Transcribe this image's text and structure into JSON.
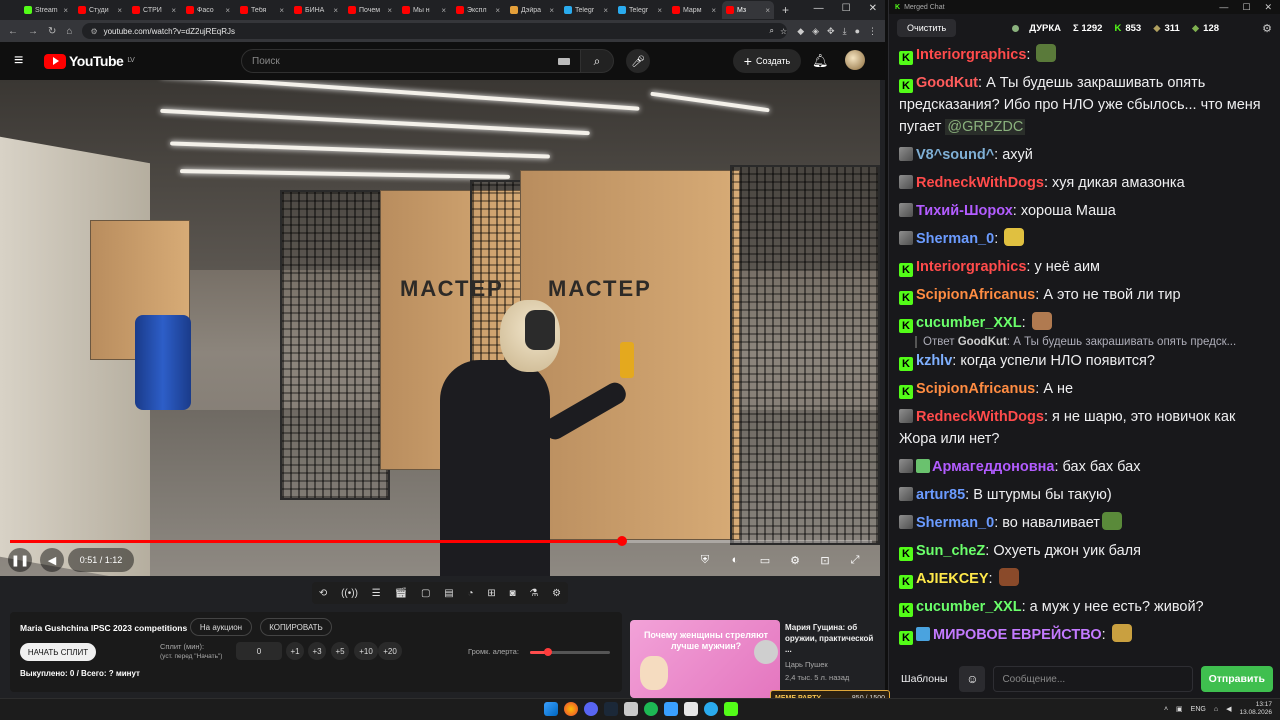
{
  "browser": {
    "tabs": [
      "Stream",
      "Студи",
      "СТРИ",
      "Фасо",
      "Тебя",
      "БИНА",
      "Почем",
      "Мы н",
      "Экспл",
      "Дэйра",
      "Telegr",
      "Telegr",
      "Марм",
      "Мз"
    ],
    "url": "youtube.com/watch?v=dZ2ujREqRJs"
  },
  "youtube": {
    "logo_text": "YouTube",
    "region": "LV",
    "search_placeholder": "Поиск",
    "create_label": "Создать",
    "video": {
      "sign1": "МАСТЕР",
      "sign2": "МАСТЕР",
      "time": "0:51 / 1:12",
      "progress_fraction": 0.71
    }
  },
  "panel": {
    "title": "Maria Gushchina IPSC 2023 competitions",
    "auction_btn": "На аукцион",
    "copy_btn": "КОПИРОВАТЬ",
    "start_split_btn": "НАЧАТЬ СПЛИТ",
    "split_label": "Сплит (мин):",
    "split_hint": "(уст. перед \"Начать\")",
    "split_value": "0",
    "increments": [
      "+1",
      "+3",
      "+5",
      "+10",
      "+20"
    ],
    "alert_label": "Громк. алерта:",
    "alert_volume_fraction": 0.22,
    "stats": "Выкуплено: 0 / Всего: ? минут"
  },
  "recommendation": {
    "thumb_text": "Почему женщины стреляют лучше мужчин?",
    "title": "Мария Гущина: об оружии, практической ...",
    "channel": "Царь Пушек",
    "meta": "2,4 тыс.  5 л. назад"
  },
  "chat": {
    "window_title": "Merged Chat",
    "clear_label": "Очистить",
    "channel": "ДУРКА",
    "total": "Σ 1292",
    "kick_count": "853",
    "twitch_count": "311",
    "other_count": "128",
    "messages": [
      {
        "badge": "k",
        "user": "Interiorgraphics",
        "color": "#ff4b4b",
        "text": "",
        "emote": "#5a7a3a"
      },
      {
        "badge": "k",
        "user": "GoodKut",
        "color": "#ff5c5c",
        "text": "А Ты будешь закрашивать опять предсказания? Ибо про НЛО уже сбылось... что меня пугает",
        "mention": "@GRPZDC"
      },
      {
        "badge": "t",
        "user": "V8^sound^",
        "color": "#7fb0d6",
        "text": "ахуй"
      },
      {
        "badge": "t",
        "user": "RedneckWithDogs",
        "color": "#ff4b4b",
        "text": "хуя дикая амазонка"
      },
      {
        "badge": "t",
        "user": "Тихий-Шорох",
        "color": "#b25cff",
        "text": "хороша Маша"
      },
      {
        "badge": "t",
        "user": "Sherman_0",
        "color": "#6b9bff",
        "text": "",
        "emote": "#e0c040"
      },
      {
        "badge": "k",
        "user": "Interiorgraphics",
        "color": "#ff4b4b",
        "text": "у неё аим"
      },
      {
        "badge": "k",
        "user": "ScipionAfricanus",
        "color": "#ff8c42",
        "text": "А это не твой ли тир"
      },
      {
        "badge": "k",
        "user": "cucumber_XXL",
        "color": "#6bff6b",
        "text": "",
        "emote": "#b07a50"
      },
      {
        "reply": true,
        "reply_prefix": "Ответ",
        "reply_user": "GoodKut",
        "reply_text": "А Ты будешь закрашивать опять предск..."
      },
      {
        "badge": "k",
        "user": "kzhlv",
        "color": "#7fb0ff",
        "text": "когда успели НЛО появится?"
      },
      {
        "badge": "k",
        "user": "ScipionAfricanus",
        "color": "#ff8c42",
        "text": "А не"
      },
      {
        "badge": "t",
        "user": "RedneckWithDogs",
        "color": "#ff4b4b",
        "text": "я не шарю, это новичок как Жора или нет?"
      },
      {
        "badge": "ts",
        "user": "Армагеддоновна",
        "color": "#b25cff",
        "text": "бах бах бах"
      },
      {
        "badge": "t",
        "user": "artur85",
        "color": "#6b9bff",
        "text": "В штурмы бы такую)"
      },
      {
        "badge": "t",
        "user": "Sherman_0",
        "color": "#6b9bff",
        "text": "во наваливает",
        "emote": "#5a8a3a"
      },
      {
        "badge": "k",
        "user": "Sun_cheZ",
        "color": "#6bff6b",
        "text": "Охуеть джон уик баля"
      },
      {
        "badge": "k",
        "user": "AJIEKCEY",
        "color": "#ffe94a",
        "text": "",
        "emote": "#8a4a2a"
      },
      {
        "badge": "k",
        "user": "cucumber_XXL",
        "color": "#6bff6b",
        "text": "а муж у нее есть? живой?"
      },
      {
        "badge": "kq",
        "user": "МИРОВОЕ ЕВРЕЙСТВО",
        "color": "#c37aff",
        "text": "",
        "emote": "#c9a040"
      }
    ],
    "templates_label": "Шаблоны",
    "input_placeholder": "Сообщение...",
    "send_label": "Отправить"
  },
  "taskbar": {
    "meme_party": "MEME PARTY",
    "meme_value": "850 / 1500",
    "lang": "ENG",
    "time": "13:17",
    "date": "13.08.2026"
  },
  "colors": {
    "kick_green": "#53fc18",
    "yt_red": "#ff0000",
    "chat_bg": "#18181b"
  }
}
